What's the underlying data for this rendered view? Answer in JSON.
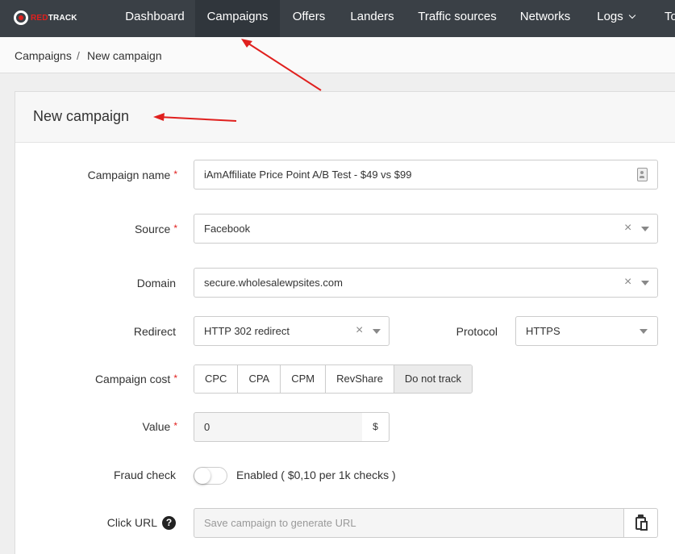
{
  "brand": {
    "logo_prefix": "RED",
    "logo_suffix": "TRACK"
  },
  "nav": {
    "items": [
      {
        "label": "Dashboard"
      },
      {
        "label": "Campaigns"
      },
      {
        "label": "Offers"
      },
      {
        "label": "Landers"
      },
      {
        "label": "Traffic sources"
      },
      {
        "label": "Networks"
      },
      {
        "label": "Logs"
      },
      {
        "label": "To"
      }
    ]
  },
  "breadcrumb": {
    "parent": "Campaigns",
    "separator": "/",
    "current": "New campaign"
  },
  "panel": {
    "title": "New campaign"
  },
  "form": {
    "required_mark": "*",
    "campaign_name": {
      "label": "Campaign name",
      "value": "iAmAffiliate Price Point A/B Test - $49 vs $99"
    },
    "source": {
      "label": "Source",
      "value": "Facebook",
      "clear": "×"
    },
    "domain": {
      "label": "Domain",
      "value": "secure.wholesalewpsites.com",
      "clear": "×"
    },
    "redirect": {
      "label": "Redirect",
      "value": "HTTP 302 redirect",
      "clear": "×"
    },
    "protocol": {
      "label": "Protocol",
      "value": "HTTPS"
    },
    "campaign_cost": {
      "label": "Campaign cost",
      "options": [
        "CPC",
        "CPA",
        "CPM",
        "RevShare",
        "Do not track"
      ],
      "selected": "Do not track"
    },
    "value": {
      "label": "Value",
      "value": "0",
      "addon": "$"
    },
    "fraud_check": {
      "label": "Fraud check",
      "enabled": false,
      "text": "Enabled ( $0,10 per 1k checks )"
    },
    "click_url": {
      "label": "Click URL",
      "help": "?",
      "placeholder": "Save campaign to generate URL"
    }
  },
  "colors": {
    "nav_bg": "#3a4046",
    "accent_red": "#e0201e",
    "annotation_arrow": "#e0201e"
  },
  "icons": [
    "logo-icon",
    "chevron-down-icon",
    "contact-card-icon",
    "close-icon",
    "caret-down-icon",
    "help-icon",
    "clipboard-icon"
  ]
}
